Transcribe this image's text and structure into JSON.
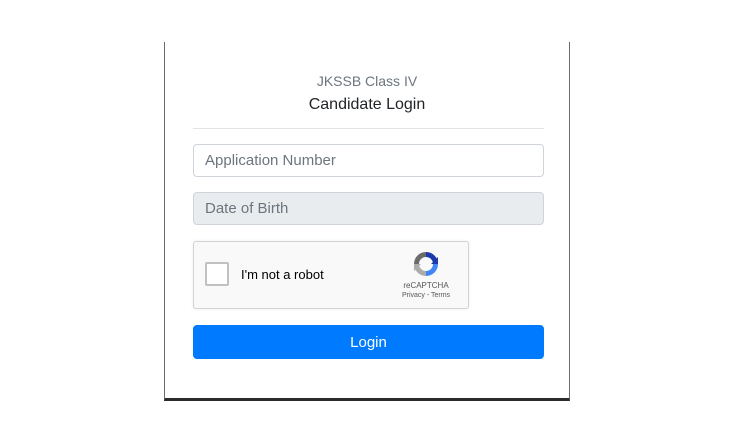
{
  "header": {
    "subtitle": "JKSSB Class IV",
    "title": "Candidate Login"
  },
  "form": {
    "application_number": {
      "placeholder": "Application Number",
      "value": ""
    },
    "date_of_birth": {
      "placeholder": "Date of Birth",
      "value": ""
    },
    "captcha": {
      "label": "I'm not a robot",
      "brand": "reCAPTCHA",
      "privacy": "Privacy",
      "separator": " - ",
      "terms": "Terms",
      "checked": false,
      "icon": "recaptcha-logo-icon"
    },
    "login_label": "Login"
  },
  "colors": {
    "primary": "#007bff",
    "disabled_field": "#e9ecef",
    "captcha_bg": "#f9f9f9",
    "text_muted": "#6c757d"
  }
}
